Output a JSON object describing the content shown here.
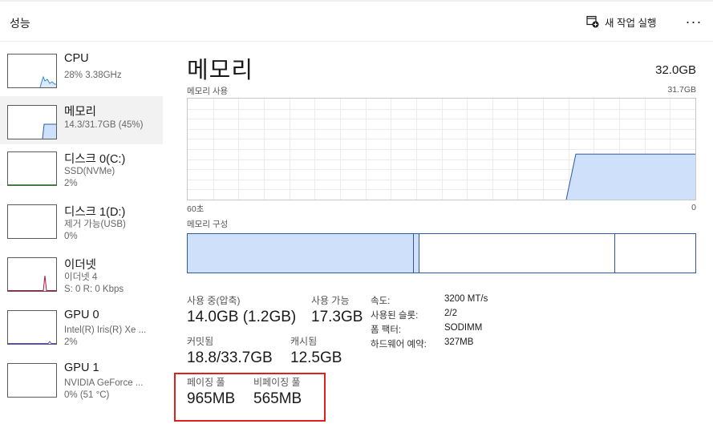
{
  "header": {
    "title": "성능",
    "new_task_label": "새 작업 실행",
    "more_label": "···"
  },
  "sidebar": {
    "items": [
      {
        "name": "CPU",
        "line1": "28% 3.38GHz",
        "line2": ""
      },
      {
        "name": "메모리",
        "line1": "14.3/31.7GB (45%)",
        "line2": ""
      },
      {
        "name": "디스크 0(C:)",
        "line1": "SSD(NVMe)",
        "line2": "2%"
      },
      {
        "name": "디스크 1(D:)",
        "line1": "제거 가능(USB)",
        "line2": "0%"
      },
      {
        "name": "이더넷",
        "line1": "이더넷 4",
        "line2": "S: 0 R: 0 Kbps"
      },
      {
        "name": "GPU 0",
        "line1": "Intel(R) Iris(R) Xe ...",
        "line2": "2%"
      },
      {
        "name": "GPU 1",
        "line1": "NVIDIA GeForce ...",
        "line2": "0% (51 °C)"
      }
    ]
  },
  "main": {
    "title": "메모리",
    "total": "32.0GB",
    "usage_label": "메모리 사용",
    "usage_max": "31.7GB",
    "axis_left": "60초",
    "axis_right": "0",
    "composition_label": "메모리 구성",
    "usage_level": 0.45,
    "stats": {
      "in_use_label": "사용 중(압축)",
      "in_use_value": "14.0GB (1.2GB)",
      "available_label": "사용 가능",
      "available_value": "17.3GB",
      "committed_label": "커밋됨",
      "committed_value": "18.8/33.7GB",
      "cached_label": "캐시됨",
      "cached_value": "12.5GB",
      "paged_label": "페이징 풀",
      "paged_value": "965MB",
      "nonpaged_label": "비페이징 풀",
      "nonpaged_value": "565MB"
    },
    "specs": {
      "speed_label": "속도:",
      "speed_value": "3200 MT/s",
      "slots_label": "사용된 슬롯:",
      "slots_value": "2/2",
      "form_label": "폼 팩터:",
      "form_value": "SODIMM",
      "reserved_label": "하드웨어 예약:",
      "reserved_value": "327MB"
    }
  },
  "colors": {
    "memory_fill": "#cfe0fa",
    "memory_line": "#2b5aa8",
    "highlight": "#e0201e",
    "network_spike": "#b3123e"
  }
}
